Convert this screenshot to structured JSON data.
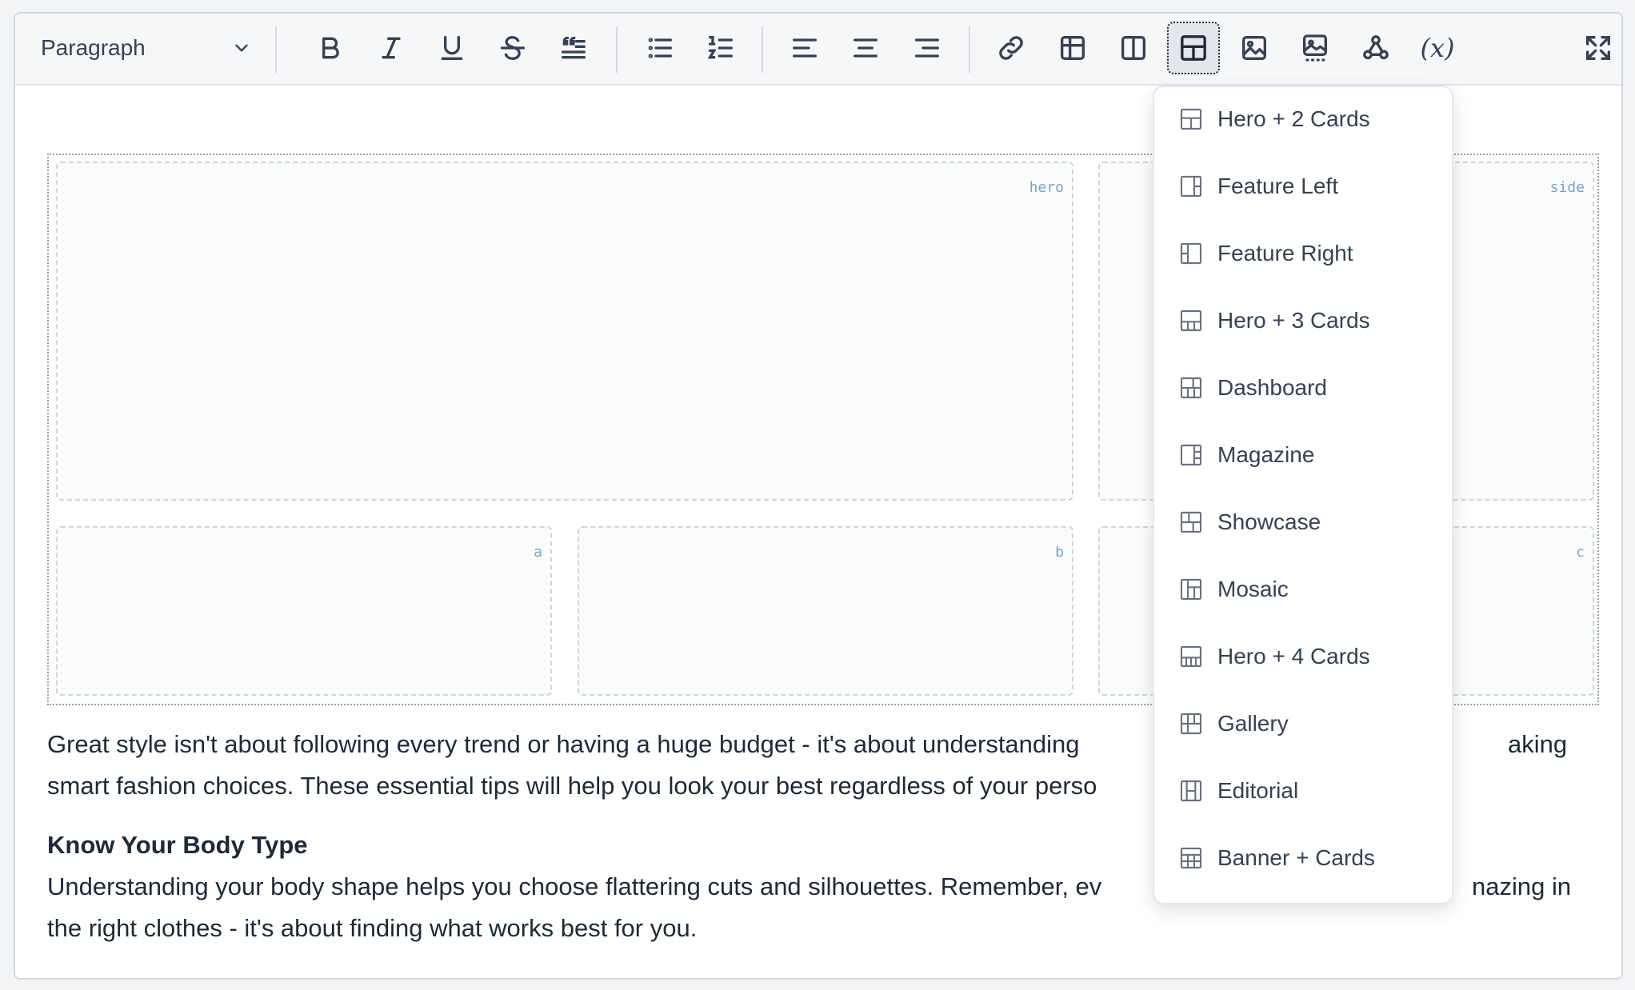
{
  "toolbar": {
    "block_format": "Paragraph",
    "buttons": [
      {
        "name": "bold-button",
        "icon": "bold-icon"
      },
      {
        "name": "italic-button",
        "icon": "italic-icon"
      },
      {
        "name": "underline-button",
        "icon": "underline-icon"
      },
      {
        "name": "strikethrough-button",
        "icon": "strikethrough-icon"
      },
      {
        "name": "blockquote-button",
        "icon": "quote-icon"
      },
      {
        "name": "bullet-list-button",
        "icon": "bullet-list-icon"
      },
      {
        "name": "numbered-list-button",
        "icon": "numbered-list-icon"
      },
      {
        "name": "align-left-button",
        "icon": "align-left-icon"
      },
      {
        "name": "align-center-button",
        "icon": "align-center-icon"
      },
      {
        "name": "align-right-button",
        "icon": "align-right-icon"
      },
      {
        "name": "link-button",
        "icon": "link-icon"
      },
      {
        "name": "table-button",
        "icon": "table-icon"
      },
      {
        "name": "columns-button",
        "icon": "columns-icon"
      },
      {
        "name": "layout-button",
        "icon": "layout-icon",
        "active": true
      },
      {
        "name": "image-button",
        "icon": "image-icon"
      },
      {
        "name": "gallery-button",
        "icon": "gallery-icon"
      },
      {
        "name": "webhook-button",
        "icon": "webhook-icon"
      },
      {
        "name": "variable-button",
        "icon": "variable-icon",
        "label": "(x)"
      },
      {
        "name": "fullscreen-button",
        "icon": "fullscreen-icon"
      }
    ]
  },
  "layout_block": {
    "cells": {
      "hero": "hero",
      "side": "side",
      "a": "a",
      "b": "b",
      "c": "c"
    }
  },
  "body": {
    "intro_line1": "Great style isn't about following every trend or having a huge budget - it's about understanding",
    "intro_line1_end": "aking",
    "intro_line2": "smart fashion choices. These essential tips will help you look your best regardless of your perso",
    "heading1": "Know Your Body Type",
    "para2_line1": "Understanding your body shape helps you choose flattering cuts and silhouettes. Remember, ev",
    "para2_line1_end": "nazing in",
    "para2_line2": "the right clothes - it's about finding what works best for you."
  },
  "layout_menu": {
    "items": [
      {
        "label": "Hero + 2 Cards",
        "icon": "hero-2-cards-icon"
      },
      {
        "label": "Feature Left",
        "icon": "feature-left-icon"
      },
      {
        "label": "Feature Right",
        "icon": "feature-right-icon"
      },
      {
        "label": "Hero + 3 Cards",
        "icon": "hero-3-cards-icon"
      },
      {
        "label": "Dashboard",
        "icon": "dashboard-icon"
      },
      {
        "label": "Magazine",
        "icon": "magazine-icon"
      },
      {
        "label": "Showcase",
        "icon": "showcase-icon"
      },
      {
        "label": "Mosaic",
        "icon": "mosaic-icon"
      },
      {
        "label": "Hero + 4 Cards",
        "icon": "hero-4-cards-icon"
      },
      {
        "label": "Gallery",
        "icon": "gallery-layout-icon"
      },
      {
        "label": "Editorial",
        "icon": "editorial-icon"
      },
      {
        "label": "Banner + Cards",
        "icon": "banner-cards-icon"
      }
    ]
  },
  "colors": {
    "accent_label": "#7aa4c6",
    "toolbar_bg": "#f6f7f9",
    "active_button_bg": "#e3e6ea"
  }
}
